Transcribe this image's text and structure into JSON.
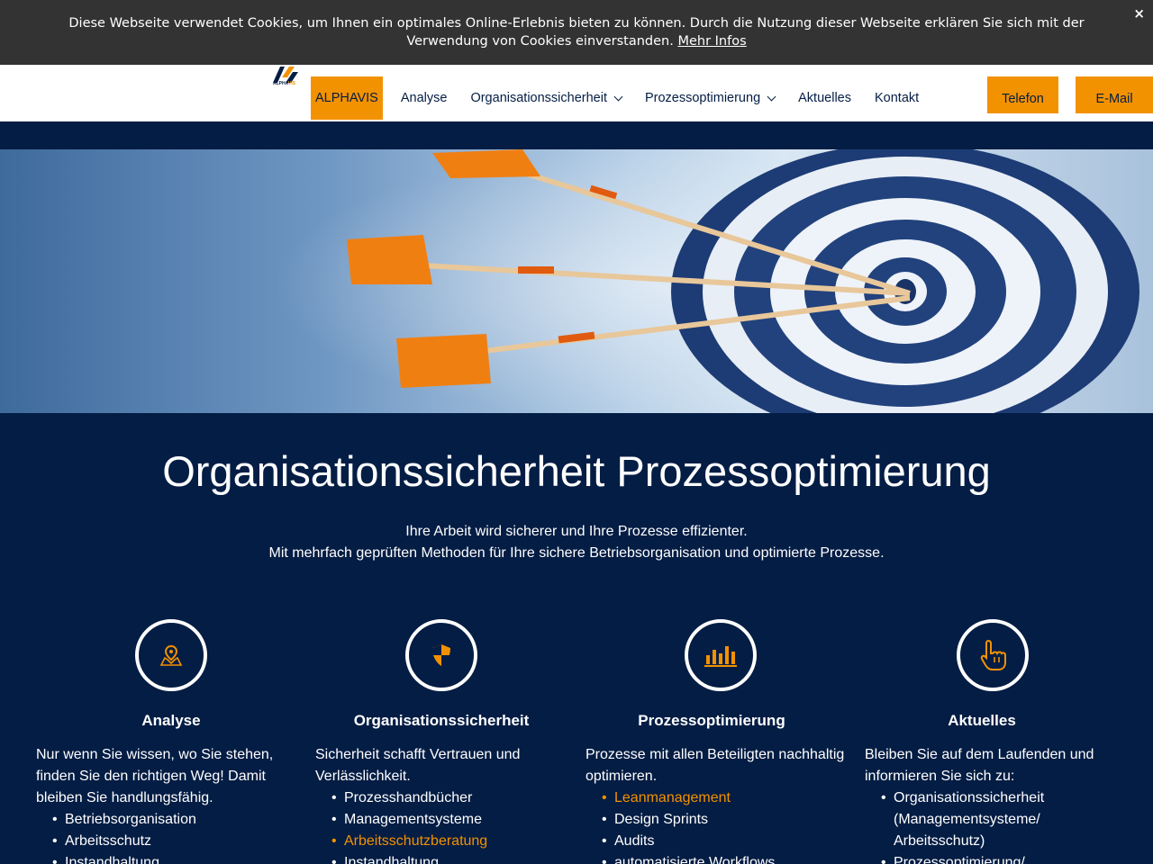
{
  "cookie": {
    "text": "Diese Webseite verwendet Cookies, um Ihnen ein optimales Online-Erlebnis bieten zu können. Durch die Nutzung dieser Webseite erklären Sie sich mit der Verwendung von Cookies einverstanden.",
    "more_link": "Mehr Infos",
    "close": "×"
  },
  "logo": {
    "text_a": "ALPHA",
    "text_b": "VIS"
  },
  "nav": {
    "items": [
      {
        "label": "ALPHAVIS"
      },
      {
        "label": "Analyse"
      },
      {
        "label": "Organisationssicherheit"
      },
      {
        "label": "Prozessoptimierung"
      },
      {
        "label": "Aktuelles"
      },
      {
        "label": "Kontakt"
      }
    ],
    "phone_button": "Telefon",
    "email_button": "E-Mail"
  },
  "intro": {
    "title_a": "Organisationssicherheit",
    "title_b": "Prozessoptimierung",
    "line1": "Ihre Arbeit wird sicherer und Ihre Prozesse effizienter.",
    "line2": "Mit mehrfach geprüften Methoden für Ihre sichere Betriebsorganisation und optimierte Prozesse."
  },
  "columns": [
    {
      "title": "Analyse",
      "text": "Nur wenn Sie wissen, wo Sie stehen, finden Sie den richtigen Weg! Damit bleiben Sie handlungsfähig.",
      "items": [
        "Betriebsorganisation",
        "Arbeitsschutz",
        "Instandhaltung"
      ]
    },
    {
      "title": "Organisationssicherheit",
      "text": "Sicherheit schafft Vertrauen und Verlässlichkeit.",
      "items": [
        "Prozesshandbücher",
        "Managementsysteme",
        "Arbeitsschutzberatung",
        "Instandhaltung"
      ]
    },
    {
      "title": "Prozessoptimierung",
      "text": "Prozesse mit allen Beteiligten nachhaltig optimieren.",
      "items": [
        "Leanmanagement",
        "Design Sprints",
        "Audits",
        "automatisierte Workflows"
      ]
    },
    {
      "title": "Aktuelles",
      "text": "Bleiben Sie auf dem Laufenden und informieren Sie sich zu:",
      "items": [
        "Organisationssicherheit (Managementsysteme/ Arbeitsschutz)",
        "Prozessoptimierung/"
      ]
    }
  ],
  "colors": {
    "navy": "#041d44",
    "orange": "#f39200",
    "cookie_bg": "#333333"
  },
  "icons": [
    "map-pin-icon",
    "shield-icon",
    "bar-chart-icon",
    "pointing-hand-icon"
  ]
}
